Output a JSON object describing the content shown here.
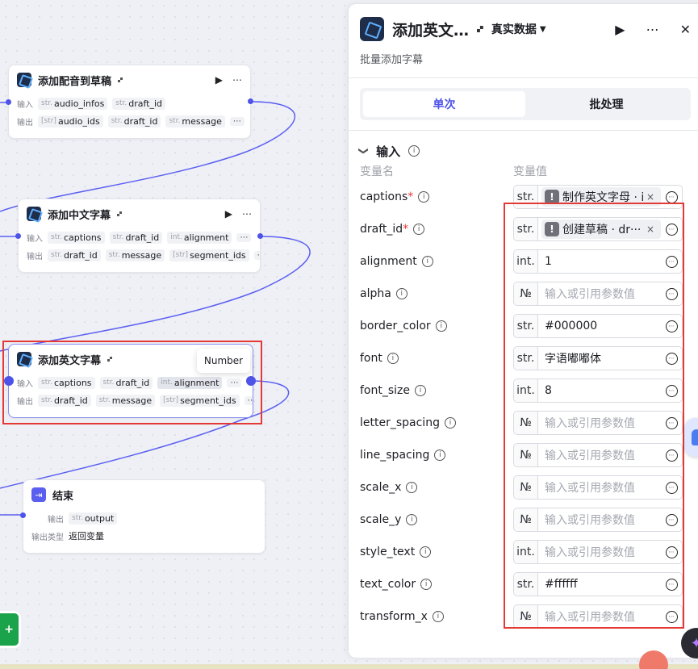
{
  "canvas": {
    "nodes": [
      {
        "title": "添加配音到草稿",
        "badge": "🙾",
        "actions": [
          "▶",
          "⋯"
        ],
        "input_label": "输入",
        "output_label": "输出",
        "inputs": [
          {
            "type": "str.",
            "name": "audio_infos"
          },
          {
            "type": "str.",
            "name": "draft_id"
          }
        ],
        "outputs": [
          {
            "type": "[str]",
            "name": "audio_ids"
          },
          {
            "type": "str.",
            "name": "draft_id"
          },
          {
            "type": "str.",
            "name": "message"
          }
        ],
        "more": "⋯"
      },
      {
        "title": "添加中文字幕",
        "badge": "🙾",
        "actions": [
          "▶",
          "⋯"
        ],
        "input_label": "输入",
        "output_label": "输出",
        "inputs": [
          {
            "type": "str.",
            "name": "captions"
          },
          {
            "type": "str.",
            "name": "draft_id"
          },
          {
            "type": "int.",
            "name": "alignment"
          }
        ],
        "outputs": [
          {
            "type": "str.",
            "name": "draft_id"
          },
          {
            "type": "str.",
            "name": "message"
          },
          {
            "type": "[str]",
            "name": "segment_ids"
          }
        ],
        "more": "⋯"
      },
      {
        "title": "添加英文字幕",
        "badge": "🙾",
        "input_label": "输入",
        "output_label": "输出",
        "inputs": [
          {
            "type": "str.",
            "name": "captions"
          },
          {
            "type": "str.",
            "name": "draft_id"
          },
          {
            "type": "int.",
            "name": "alignment"
          }
        ],
        "outputs": [
          {
            "type": "str.",
            "name": "draft_id"
          },
          {
            "type": "str.",
            "name": "message"
          },
          {
            "type": "[str]",
            "name": "segment_ids"
          }
        ],
        "more": "⋯"
      },
      {
        "title": "结束",
        "output_label": "输出",
        "output": {
          "type": "str.",
          "name": "output"
        },
        "output_type_label": "输出类型",
        "output_type_value": "返回变量"
      }
    ],
    "tooltip": "Number",
    "fab_label": "+"
  },
  "panel": {
    "title": "添加英文…",
    "badge": "🙾",
    "source": "真实数据",
    "source_caret": "▼",
    "run_icon": "▶",
    "more_icon": "⋯",
    "close_icon": "✕",
    "description": "批量添加字幕",
    "tabs": [
      {
        "label": "单次",
        "active": true
      },
      {
        "label": "批处理",
        "active": false
      }
    ],
    "section_chevron": "❯",
    "section_title": "输入",
    "col_name": "变量名",
    "col_value": "变量值",
    "variables": [
      {
        "name": "captions",
        "required": true,
        "type": "str.",
        "mode": "ref",
        "value": "制作英文字母 · i··"
      },
      {
        "name": "draft_id",
        "required": true,
        "type": "str.",
        "mode": "ref",
        "value": "创建草稿 · dr···"
      },
      {
        "name": "alignment",
        "required": false,
        "type": "int.",
        "mode": "value",
        "value": "1"
      },
      {
        "name": "alpha",
        "required": false,
        "type": "№",
        "mode": "placeholder",
        "value": "输入或引用参数值"
      },
      {
        "name": "border_color",
        "required": false,
        "type": "str.",
        "mode": "value",
        "value": "#000000"
      },
      {
        "name": "font",
        "required": false,
        "type": "str.",
        "mode": "value",
        "value": "字语嘟嘟体"
      },
      {
        "name": "font_size",
        "required": false,
        "type": "int.",
        "mode": "value",
        "value": "8"
      },
      {
        "name": "letter_spacing",
        "required": false,
        "type": "№",
        "mode": "placeholder",
        "value": "输入或引用参数值"
      },
      {
        "name": "line_spacing",
        "required": false,
        "type": "№",
        "mode": "placeholder",
        "value": "输入或引用参数值"
      },
      {
        "name": "scale_x",
        "required": false,
        "type": "№",
        "mode": "placeholder",
        "value": "输入或引用参数值"
      },
      {
        "name": "scale_y",
        "required": false,
        "type": "№",
        "mode": "placeholder",
        "value": "输入或引用参数值"
      },
      {
        "name": "style_text",
        "required": false,
        "type": "int.",
        "mode": "placeholder",
        "value": "输入或引用参数值"
      },
      {
        "name": "text_color",
        "required": false,
        "type": "str.",
        "mode": "value",
        "value": "#ffffff"
      },
      {
        "name": "transform_x",
        "required": false,
        "type": "№",
        "mode": "placeholder",
        "value": "输入或引用参数值"
      }
    ],
    "clear_icon": "×",
    "warn_icon": "!",
    "info_icon": "i",
    "variable_icon": "⋯"
  },
  "colors": {
    "accent": "#4d53e8",
    "highlight_red": "#e53935",
    "edge": "#5b5ff0"
  }
}
